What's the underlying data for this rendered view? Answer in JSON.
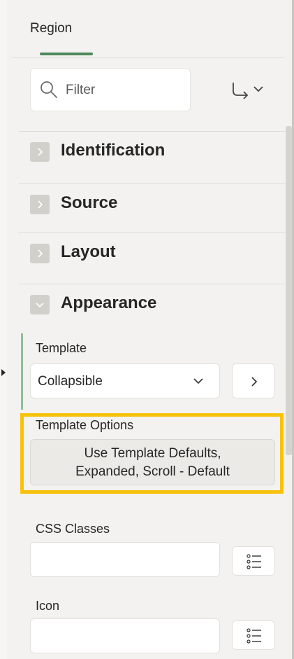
{
  "tabs": [
    {
      "label": "Region",
      "active": true
    }
  ],
  "filter": {
    "placeholder": "Filter",
    "value": ""
  },
  "sections": [
    {
      "title": "Identification",
      "expanded": false
    },
    {
      "title": "Source",
      "expanded": false
    },
    {
      "title": "Layout",
      "expanded": false
    },
    {
      "title": "Appearance",
      "expanded": true
    }
  ],
  "appearance": {
    "template": {
      "label": "Template",
      "value": "Collapsible"
    },
    "template_options": {
      "label": "Template Options",
      "value_line1": "Use Template Defaults,",
      "value_line2": "Expanded, Scroll - Default"
    },
    "css_classes": {
      "label": "CSS Classes",
      "value": ""
    },
    "icon": {
      "label": "Icon",
      "value": ""
    }
  },
  "colors": {
    "accent_green": "#4e8a5a",
    "active_bar": "#8fbf98",
    "highlight_yellow": "#f7c20b",
    "panel_bg": "#f3f2f0"
  }
}
